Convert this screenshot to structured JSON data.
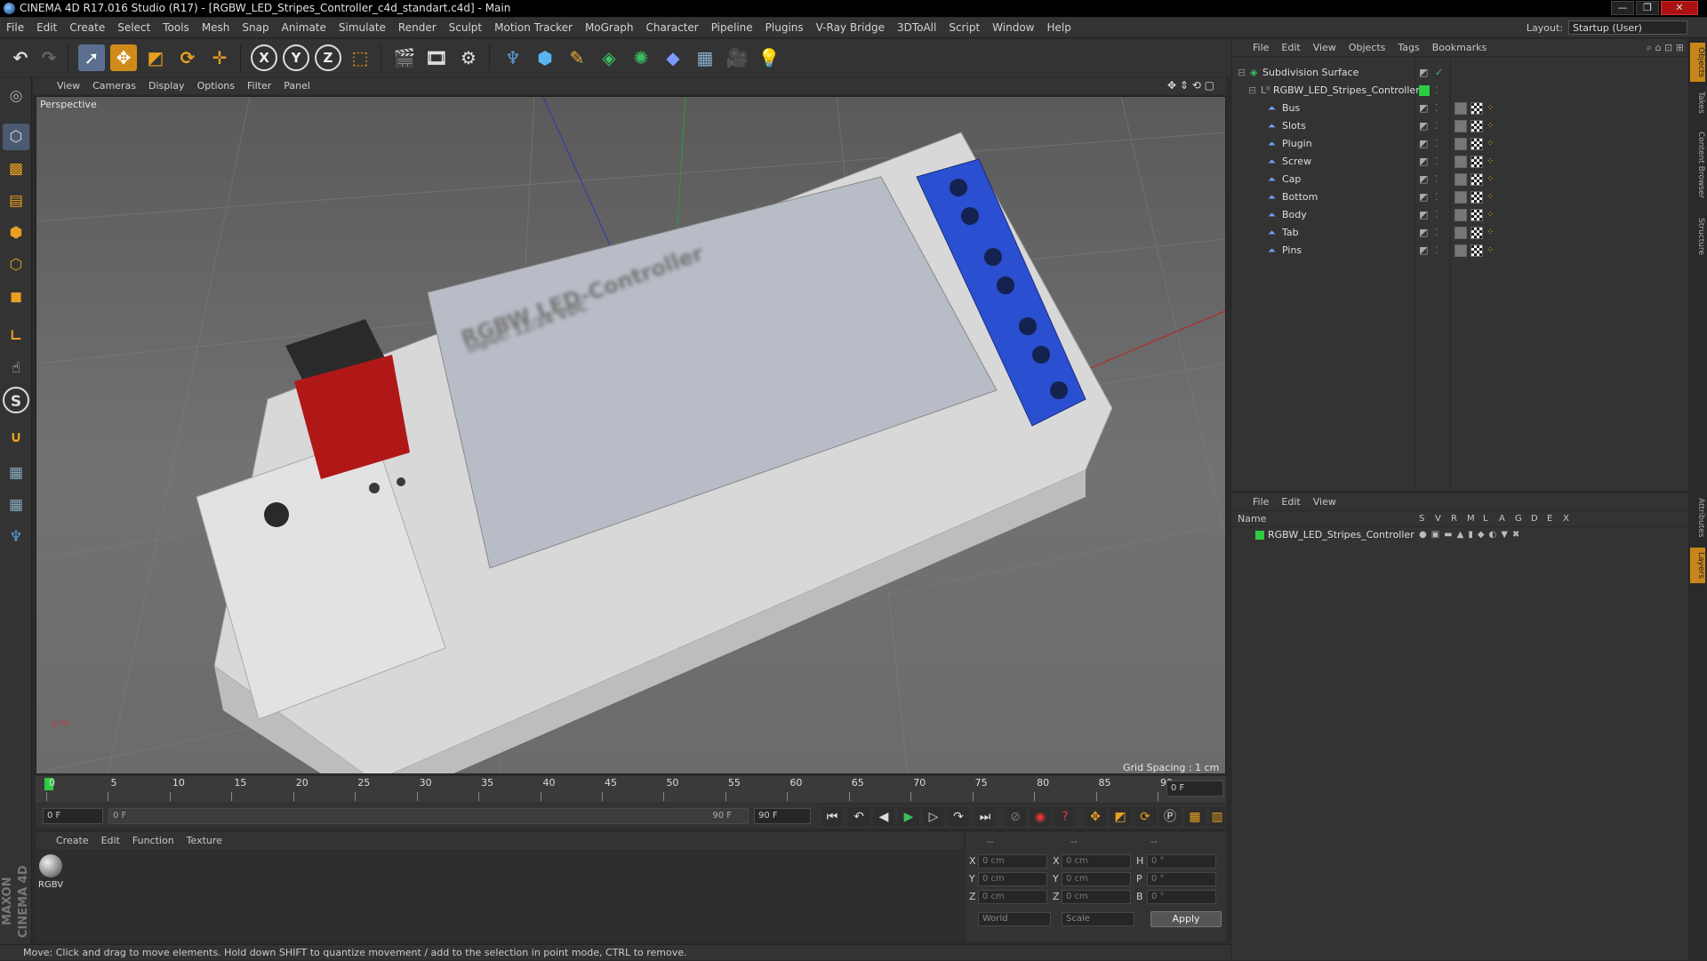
{
  "window": {
    "title": "CINEMA 4D R17.016 Studio (R17) - [RGBW_LED_Stripes_Controller_c4d_standart.c4d] - Main"
  },
  "menubar": {
    "items": [
      "File",
      "Edit",
      "Create",
      "Select",
      "Tools",
      "Mesh",
      "Snap",
      "Animate",
      "Simulate",
      "Render",
      "Sculpt",
      "Motion Tracker",
      "MoGraph",
      "Character",
      "Pipeline",
      "Plugins",
      "V-Ray Bridge",
      "3DToAll",
      "Script",
      "Window",
      "Help"
    ],
    "layout_label": "Layout:",
    "layout_value": "Startup (User)"
  },
  "toolbar": {
    "axis_x": "X",
    "axis_y": "Y",
    "axis_z": "Z"
  },
  "viewport": {
    "menu": [
      "View",
      "Cameras",
      "Display",
      "Options",
      "Filter",
      "Panel"
    ],
    "label": "Perspective",
    "grid_spacing": "Grid Spacing : 1 cm"
  },
  "model": {
    "colors": {
      "body": "#d8d8d8",
      "terminal": "#2a4fd0",
      "switch_red": "#b01818",
      "switch_black": "#2a2a2a"
    },
    "label_lines": [
      "RGBW LED-Controller",
      "Input: 12/24 VDC"
    ]
  },
  "timeline": {
    "ticks": [
      "0",
      "5",
      "10",
      "15",
      "20",
      "25",
      "30",
      "35",
      "40",
      "45",
      "50",
      "55",
      "60",
      "65",
      "70",
      "75",
      "80",
      "85",
      "90"
    ],
    "current_frame": "0 F"
  },
  "transport": {
    "start": "0 F",
    "range_start": "0 F",
    "range_end": "90 F",
    "end": "90 F"
  },
  "material": {
    "menu": [
      "Create",
      "Edit",
      "Function",
      "Texture"
    ],
    "thumb_label": "RGBV"
  },
  "coords": {
    "dashes": [
      "--",
      "--",
      "--"
    ],
    "rows": [
      {
        "a": "X",
        "av": "0 cm",
        "b": "X",
        "bv": "0 cm",
        "c": "H",
        "cv": "0 °"
      },
      {
        "a": "Y",
        "av": "0 cm",
        "b": "Y",
        "bv": "0 cm",
        "c": "P",
        "cv": "0 °"
      },
      {
        "a": "Z",
        "av": "0 cm",
        "b": "Z",
        "bv": "0 cm",
        "c": "B",
        "cv": "0 °"
      }
    ],
    "space": "World",
    "mode": "Scale",
    "apply": "Apply"
  },
  "status": "Move: Click and drag to move elements. Hold down SHIFT to quantize movement / add to the selection in point mode, CTRL to remove.",
  "objects": {
    "menu": [
      "File",
      "Edit",
      "View",
      "Objects",
      "Tags",
      "Bookmarks"
    ],
    "root": "Subdivision Surface",
    "group": "RGBW_LED_Stripes_Controller",
    "children": [
      "Bus",
      "Slots",
      "Plugin",
      "Screw",
      "Cap",
      "Bottom",
      "Body",
      "Tab",
      "Pins"
    ]
  },
  "layers": {
    "menu": [
      "File",
      "Edit",
      "View"
    ],
    "header_name": "Name",
    "header_cols": [
      "S",
      "V",
      "R",
      "M",
      "L",
      "A",
      "G",
      "D",
      "E",
      "X"
    ],
    "row": "RGBW_LED_Stripes_Controller",
    "row_color": "#2ecc40"
  },
  "sidetabs": {
    "top": [
      "Objects",
      "Takes",
      "Content Browser",
      "Structure"
    ],
    "bottom": [
      "Attributes",
      "Layers"
    ]
  }
}
